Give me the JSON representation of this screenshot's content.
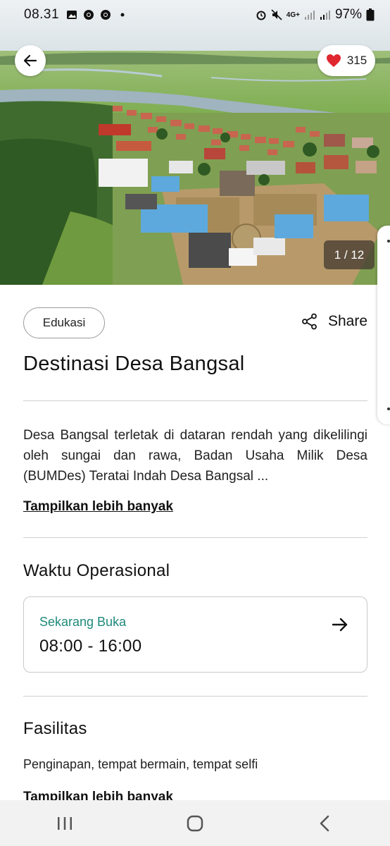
{
  "status_bar": {
    "time": "08.31",
    "battery": "97%",
    "network": "4G+"
  },
  "hero": {
    "like_count": "315",
    "photo_counter": "1 / 12",
    "colors": {
      "heart": "#e0262f",
      "counter_bg": "#4a3f35"
    }
  },
  "content": {
    "category_chip": "Edukasi",
    "share_label": "Share",
    "title": "Destinasi Desa Bangsal",
    "description": "Desa Bangsal terletak di dataran rendah yang dikelilingi oleh sungai dan rawa, Badan Usaha Milik Desa (BUMDes) Teratai Indah Desa Bangsal ...",
    "show_more_1": "Tampilkan lebih banyak",
    "operational": {
      "heading": "Waktu Operasional",
      "status": "Sekarang Buka",
      "hours": "08:00 - 16:00",
      "status_color": "#1f8a7a"
    },
    "facilities": {
      "heading": "Fasilitas",
      "text": "Penginapan, tempat bermain, tempat selfi",
      "show_more": "Tampilkan lebih banyak"
    }
  },
  "nav": {
    "icons": [
      "recent-apps-icon",
      "home-icon",
      "back-icon"
    ]
  }
}
